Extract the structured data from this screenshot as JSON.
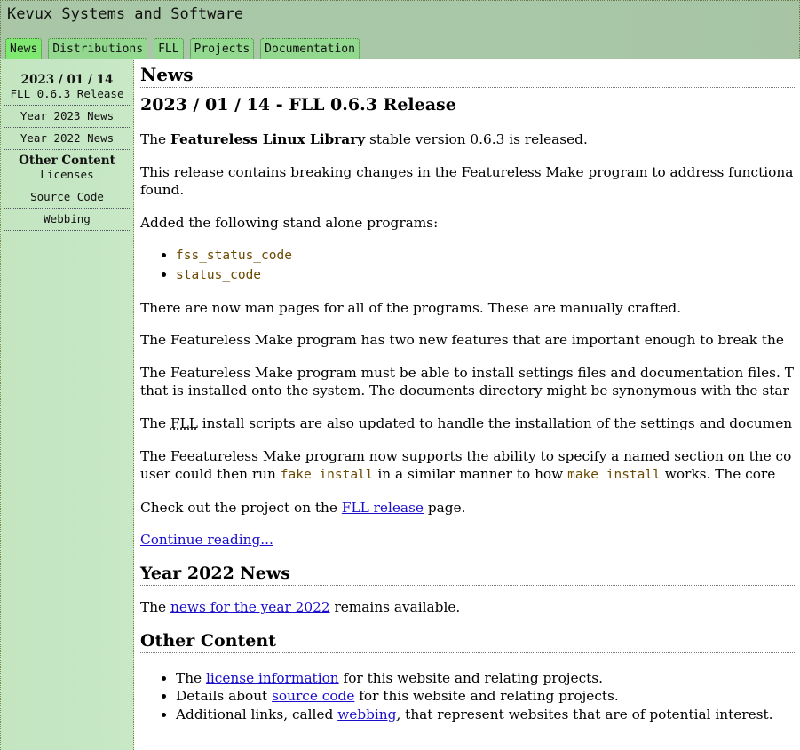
{
  "header": {
    "title": "Kevux Systems and Software",
    "tabs": [
      {
        "label": "News",
        "active": true
      },
      {
        "label": "Distributions"
      },
      {
        "label": "FLL"
      },
      {
        "label": "Projects"
      },
      {
        "label": "Documentation"
      }
    ]
  },
  "sidebar": {
    "current": {
      "date": "2023 / 01 / 14",
      "label": "FLL 0.6.3 Release"
    },
    "items": [
      "Year 2023 News",
      "Year 2022 News"
    ],
    "other_heading": "Other Content",
    "other_items": [
      "Licenses",
      "Source Code",
      "Webbing"
    ]
  },
  "main": {
    "title": "News",
    "article_title": "2023 / 01 / 14 - FLL 0.6.3 Release",
    "p1": {
      "a": "The ",
      "b": "Featureless Linux Library",
      "c": " stable version 0.6.3 is released."
    },
    "p2": [
      "This release contains breaking changes in the Featureless Make program to address functiona",
      "found."
    ],
    "p3": "Added the following stand alone programs:",
    "programs": [
      "fss_status_code",
      "status_code"
    ],
    "p4": "There are now man pages for all of the programs. These are manually crafted.",
    "p5": "The Featureless Make program has two new features that are important enough to break the",
    "p6": [
      "The Featureless Make program must be able to install settings files and documentation files. T",
      "that is installed onto the system. The documents directory might be synonymous with the star"
    ],
    "p7": {
      "a": "The ",
      "abbr": "FLL",
      "b": " install scripts are also updated to handle the installation of the settings and documen"
    },
    "p8": {
      "line1": "The Feeatureless Make program now supports the ability to specify a named section on the co",
      "a": "user could then run ",
      "code1": "fake install",
      "b": " in a similar manner to how ",
      "code2": "make install",
      "c": " works. The core"
    },
    "p9": {
      "a": "Check out the project on the ",
      "link": "FLL release",
      "b": " page."
    },
    "continue": "Continue reading...",
    "year2022": {
      "title": "Year 2022 News",
      "a": "The ",
      "link": "news for the year 2022",
      "b": " remains available."
    },
    "other": {
      "title": "Other Content",
      "items": [
        {
          "a": "The ",
          "link": "license information",
          "b": " for this website and relating projects."
        },
        {
          "a": "Details about ",
          "link": "source code",
          "b": " for this website and relating projects."
        },
        {
          "a": "Additional links, called ",
          "link": "webbing",
          "b": ", that represent websites that are of potential interest."
        }
      ]
    }
  }
}
